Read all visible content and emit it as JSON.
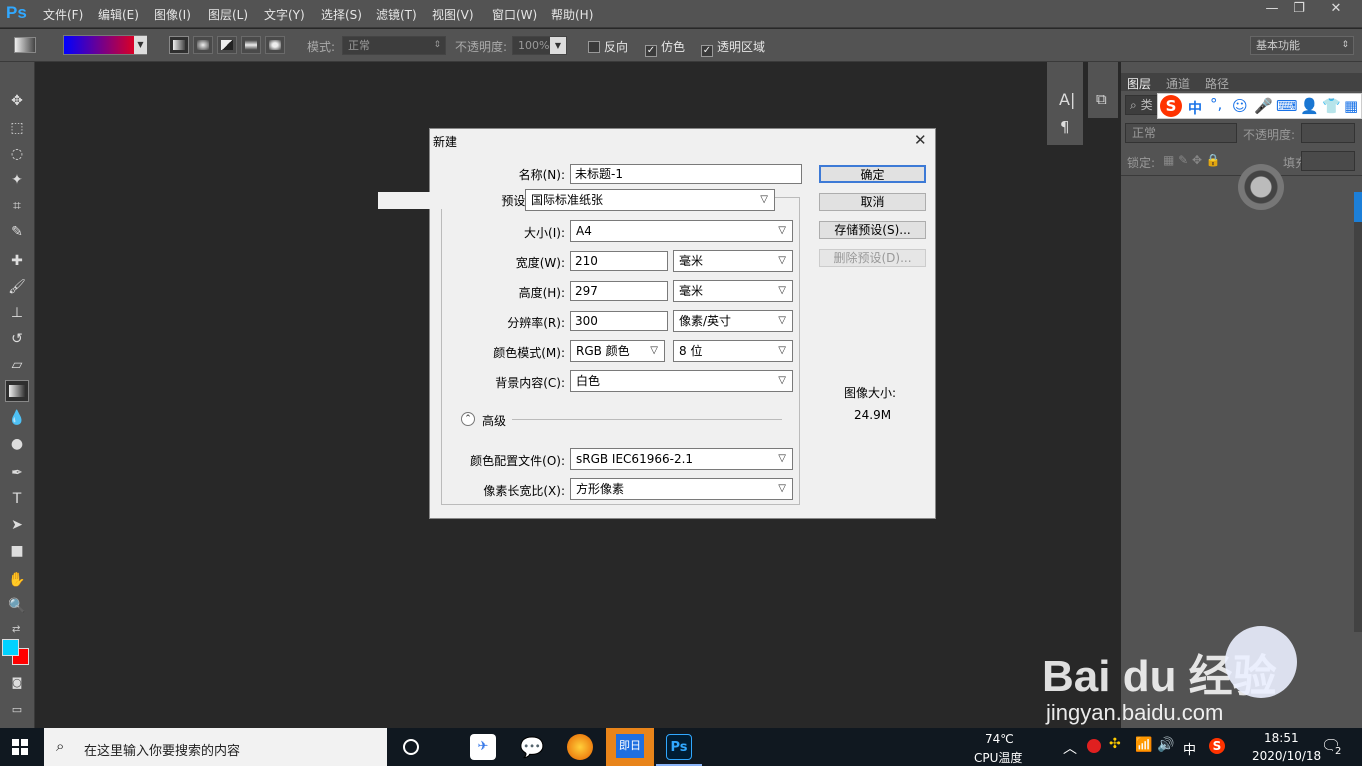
{
  "app": {
    "logo": "Ps"
  },
  "menu": [
    "文件(F)",
    "编辑(E)",
    "图像(I)",
    "图层(L)",
    "文字(Y)",
    "选择(S)",
    "滤镜(T)",
    "视图(V)",
    "窗口(W)",
    "帮助(H)"
  ],
  "window_controls": {
    "minimize": "—",
    "restore": "❐",
    "close": "✕"
  },
  "options": {
    "mode_label": "模式:",
    "mode_value": "正常",
    "opacity_label": "不透明度:",
    "opacity_value": "100%",
    "reverse": "反向",
    "dither": "仿色",
    "transparency": "透明区域",
    "workspace": "基本功能",
    "gradient_colors": [
      "#0000ff",
      "#ff0000"
    ]
  },
  "colors": {
    "foreground": "#00d2ff",
    "background": "#ff0000",
    "accent": "#31a8ff"
  },
  "layers_panel": {
    "tabs": [
      "图层",
      "通道",
      "路径"
    ],
    "filter_label": "类",
    "blend_value": "正常",
    "opacity_label": "不透明度:",
    "lock_label": "锁定:",
    "fill_label": "填充:"
  },
  "ime_bar": {
    "logo": "S",
    "lang": "中"
  },
  "dialog": {
    "title": "新建",
    "close": "✕",
    "name_label": "名称(N):",
    "name_value": "未标题-1",
    "preset_label": "预设(P):",
    "preset_value": "国际标准纸张",
    "size_label": "大小(I):",
    "size_value": "A4",
    "width_label": "宽度(W):",
    "width_value": "210",
    "width_unit": "毫米",
    "height_label": "高度(H):",
    "height_value": "297",
    "height_unit": "毫米",
    "resolution_label": "分辨率(R):",
    "resolution_value": "300",
    "resolution_unit": "像素/英寸",
    "color_mode_label": "颜色模式(M):",
    "color_mode_value": "RGB 颜色",
    "bit_depth": "8 位",
    "background_label": "背景内容(C):",
    "background_value": "白色",
    "advanced": "高级",
    "profile_label": "颜色配置文件(O):",
    "profile_value": "sRGB IEC61966-2.1",
    "aspect_label": "像素长宽比(X):",
    "aspect_value": "方形像素",
    "ok": "确定",
    "cancel": "取消",
    "save_preset": "存储预设(S)...",
    "delete_preset": "删除预设(D)...",
    "image_size_label": "图像大小:",
    "image_size_value": "24.9M"
  },
  "watermark": {
    "brand": "Bai du 经验",
    "url": "jingyan.baidu.com"
  },
  "taskbar": {
    "search_placeholder": "在这里输入你要搜索的内容",
    "apps": [
      "即日",
      "Ps"
    ],
    "temp": "74℃",
    "temp_label": "CPU温度",
    "ime": "中",
    "time": "18:51",
    "date": "2020/10/18",
    "notifications": "2"
  }
}
